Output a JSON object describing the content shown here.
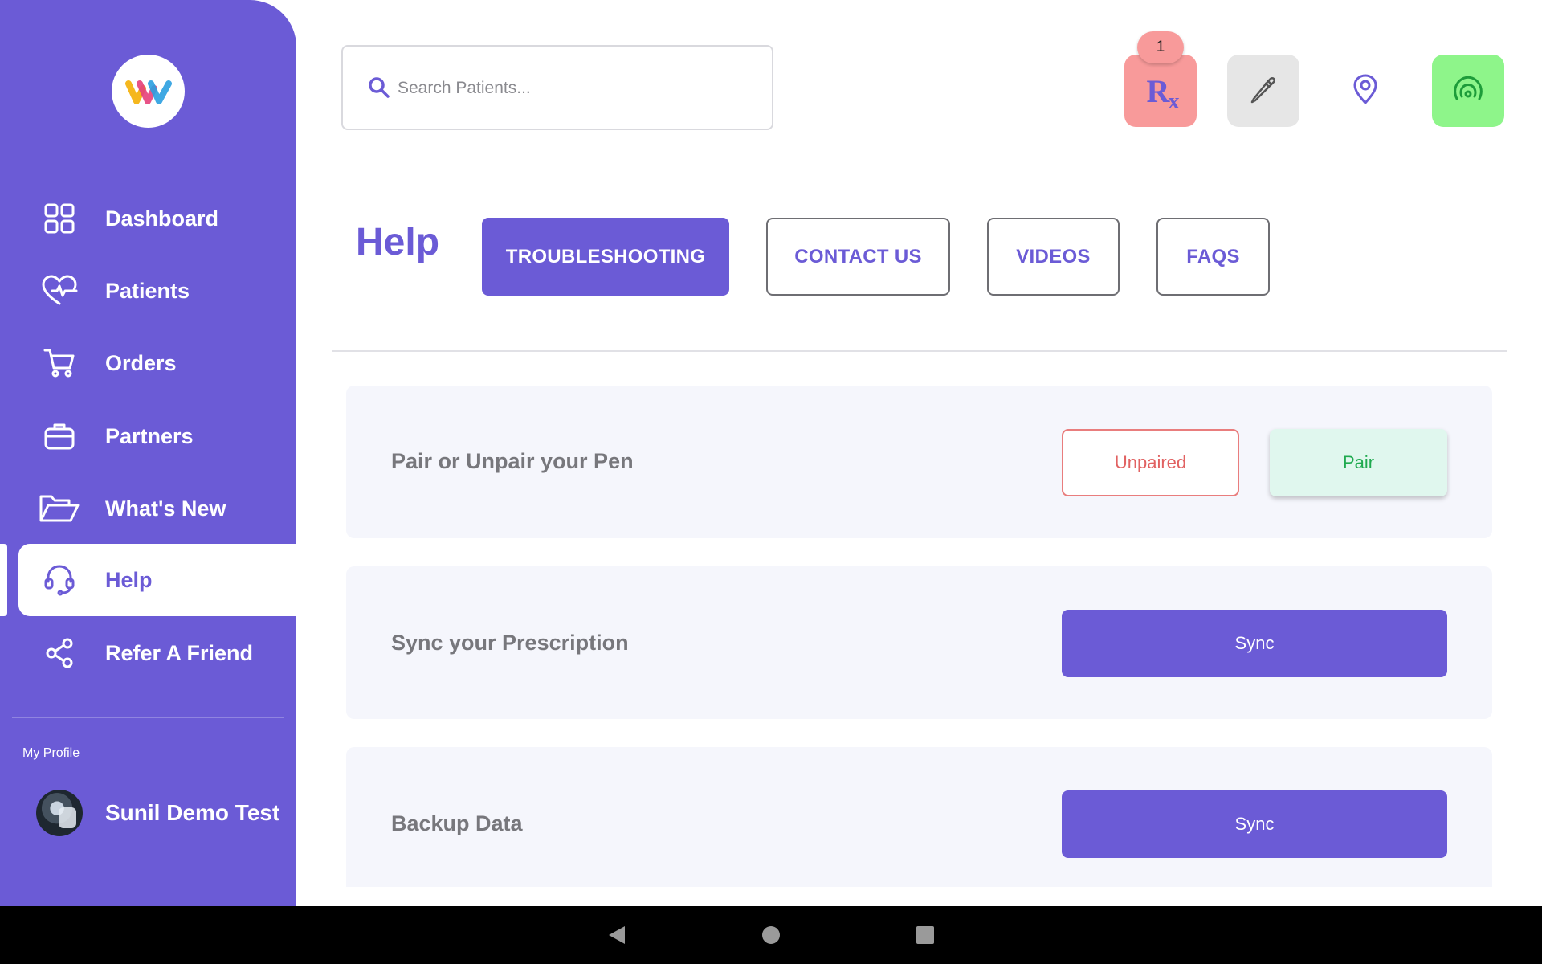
{
  "sidebar": {
    "items": [
      {
        "label": "Dashboard",
        "icon": "dashboard-grid-icon"
      },
      {
        "label": "Patients",
        "icon": "heart-pulse-icon"
      },
      {
        "label": "Orders",
        "icon": "cart-icon"
      },
      {
        "label": "Partners",
        "icon": "briefcase-icon"
      },
      {
        "label": "What's New",
        "icon": "folder-open-icon"
      },
      {
        "label": "Help",
        "icon": "headset-icon",
        "active": true
      },
      {
        "label": "Refer A Friend",
        "icon": "share-icon"
      }
    ],
    "profile_caption": "My Profile",
    "profile_name": "Sunil Demo Test"
  },
  "search": {
    "placeholder": "Search Patients..."
  },
  "toolbar": {
    "rx_badge": "1",
    "rx_label": "R",
    "rx_sub": "x"
  },
  "header": {
    "title": "Help",
    "tabs": [
      {
        "label": "TROUBLESHOOTING",
        "active": true
      },
      {
        "label": "CONTACT US"
      },
      {
        "label": "VIDEOS"
      },
      {
        "label": "FAQS"
      }
    ]
  },
  "cards": [
    {
      "title": "Pair or Unpair your Pen",
      "secondary_button": "Unpaired",
      "primary_button": "Pair"
    },
    {
      "title": "Sync your Prescription",
      "button": "Sync"
    },
    {
      "title": "Backup Data",
      "button": "Sync"
    }
  ],
  "colors": {
    "brand": "#6b5bd6",
    "rx_bg": "#f89a9a",
    "pen_bg": "#e6e6e6",
    "signal_bg": "#8ef58a",
    "unpaired": "#e16262",
    "pair": "#1faa4f"
  }
}
